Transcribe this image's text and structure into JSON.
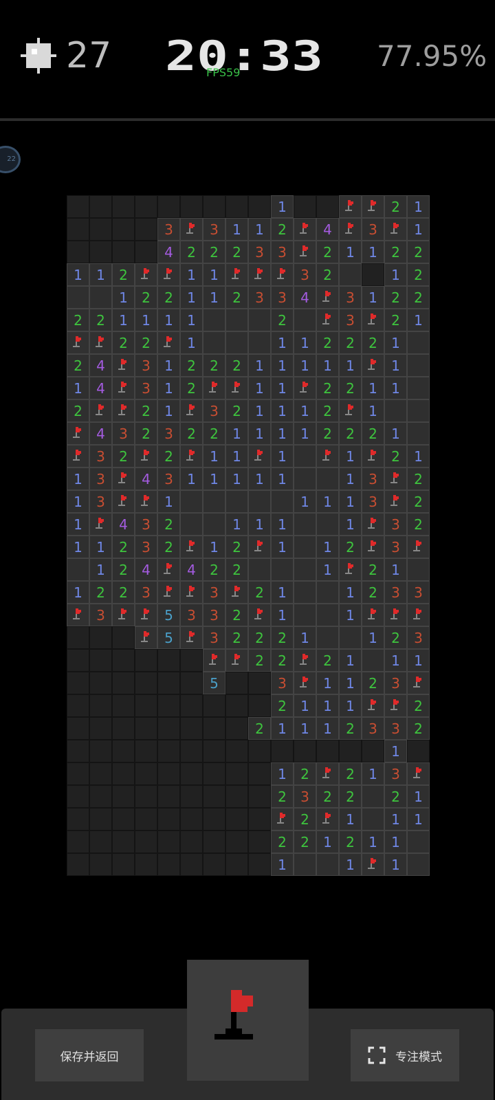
{
  "header": {
    "mine_icon": "mine-icon",
    "mines_left": "27",
    "timer": "20:33",
    "fps": "FPS59",
    "progress": "77.95%"
  },
  "side_badge": {
    "label": "22"
  },
  "board": {
    "cols": 16,
    "rows": 30,
    "legend": "H = unrevealed cell, 0 = revealed empty, 1-8 = adjacent mine count, F = flag",
    "number_colors": {
      "1": "#6f87e6",
      "2": "#3ec43e",
      "3": "#c84e32",
      "4": "#a45be0",
      "5": "#4a9fc8"
    },
    "flag_color": "#e02a2a",
    "grid": [
      "HHHHHHHHH1HHFF21",
      "HHHH3F3112F4F3F1",
      "HHHH422233F21122",
      "112FF11FFF320H12F",
      "00122112334F3122",
      "22111100020F3F211",
      "FF22F10001122210",
      "24F3122211111F10",
      "14F312FF11F22110",
      "2FF21F321112F100",
      "F4323221111222100",
      "F32F2F11F10F1F210",
      "13F43111110013F20",
      "13FF1000001113F20",
      "1F43200111001F3220",
      "11232F12F1012F3F10",
      "0124F4220001F210",
      "1223FF3F210012332",
      "F3FF5332F1001FFF",
      "HHHF5F3222100123 2",
      "HHHHHHFF22F2101 11",
      "HHHHHH5HH3F1123F",
      "HHHHHHHHH2111FF2",
      "HHHHHHHH21112332",
      "HHHHHHHHHHHHHH1H",
      "HHHHHHHHH12F213F",
      "HHHHHHHHH2322021F",
      "HHHHHHHHHF2F1011",
      "HHHHHHHHH2212110",
      "HHHHHHHHH1001F10"
    ]
  },
  "controls": {
    "save_label": "保存并返回",
    "focus_label": "专注模式",
    "flag_mode_icon": "flag-icon",
    "focus_icon": "fullscreen-icon"
  }
}
